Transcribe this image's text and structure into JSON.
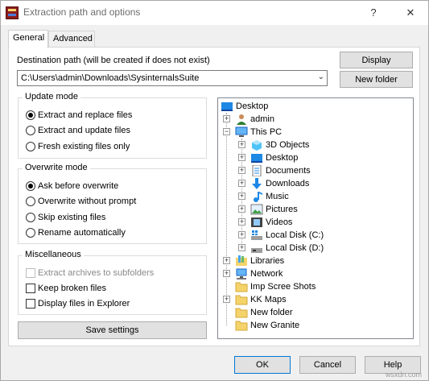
{
  "window": {
    "title": "Extraction path and options",
    "help_glyph": "?",
    "close_glyph": "✕"
  },
  "tabs": [
    {
      "label": "General"
    },
    {
      "label": "Advanced"
    }
  ],
  "destination": {
    "label": "Destination path (will be created if does not exist)",
    "value": "C:\\Users\\admin\\Downloads\\SysinternalsSuite",
    "display_button": "Display",
    "new_folder_button": "New folder"
  },
  "update_mode": {
    "title": "Update mode",
    "options": [
      {
        "label": "Extract and replace files",
        "selected": true
      },
      {
        "label": "Extract and update files",
        "selected": false
      },
      {
        "label": "Fresh existing files only",
        "selected": false
      }
    ]
  },
  "overwrite_mode": {
    "title": "Overwrite mode",
    "options": [
      {
        "label": "Ask before overwrite",
        "selected": true
      },
      {
        "label": "Overwrite without prompt",
        "selected": false
      },
      {
        "label": "Skip existing files",
        "selected": false
      },
      {
        "label": "Rename automatically",
        "selected": false
      }
    ]
  },
  "misc": {
    "title": "Miscellaneous",
    "options": [
      {
        "label": "Extract archives to subfolders",
        "checked": false,
        "disabled": true
      },
      {
        "label": "Keep broken files",
        "checked": false,
        "disabled": false
      },
      {
        "label": "Display files in Explorer",
        "checked": false,
        "disabled": false
      }
    ]
  },
  "save_settings_button": "Save settings",
  "tree": {
    "items": [
      {
        "label": "Desktop",
        "icon": "desktop-icon"
      },
      {
        "label": "admin",
        "icon": "user-icon"
      },
      {
        "label": "This PC",
        "icon": "computer-icon"
      },
      {
        "label": "3D Objects",
        "icon": "cube-icon"
      },
      {
        "label": "Desktop",
        "icon": "desktop-icon"
      },
      {
        "label": "Documents",
        "icon": "document-icon"
      },
      {
        "label": "Downloads",
        "icon": "download-icon"
      },
      {
        "label": "Music",
        "icon": "music-icon"
      },
      {
        "label": "Pictures",
        "icon": "picture-icon"
      },
      {
        "label": "Videos",
        "icon": "video-icon"
      },
      {
        "label": "Local Disk (C:)",
        "icon": "windows-drive-icon"
      },
      {
        "label": "Local Disk (D:)",
        "icon": "drive-icon"
      },
      {
        "label": "Libraries",
        "icon": "library-icon"
      },
      {
        "label": "Network",
        "icon": "network-icon"
      },
      {
        "label": "Imp Scree Shots",
        "icon": "folder-icon"
      },
      {
        "label": "KK Maps",
        "icon": "folder-icon"
      },
      {
        "label": "New folder",
        "icon": "folder-icon"
      },
      {
        "label": "New Granite",
        "icon": "folder-icon"
      }
    ]
  },
  "footer": {
    "ok": "OK",
    "cancel": "Cancel",
    "help": "Help"
  },
  "watermark": "wsxdn.com",
  "colors": {
    "accent": "#0078d7",
    "folder": "#f5d36b",
    "desktop_blue": "#1e88e5"
  }
}
